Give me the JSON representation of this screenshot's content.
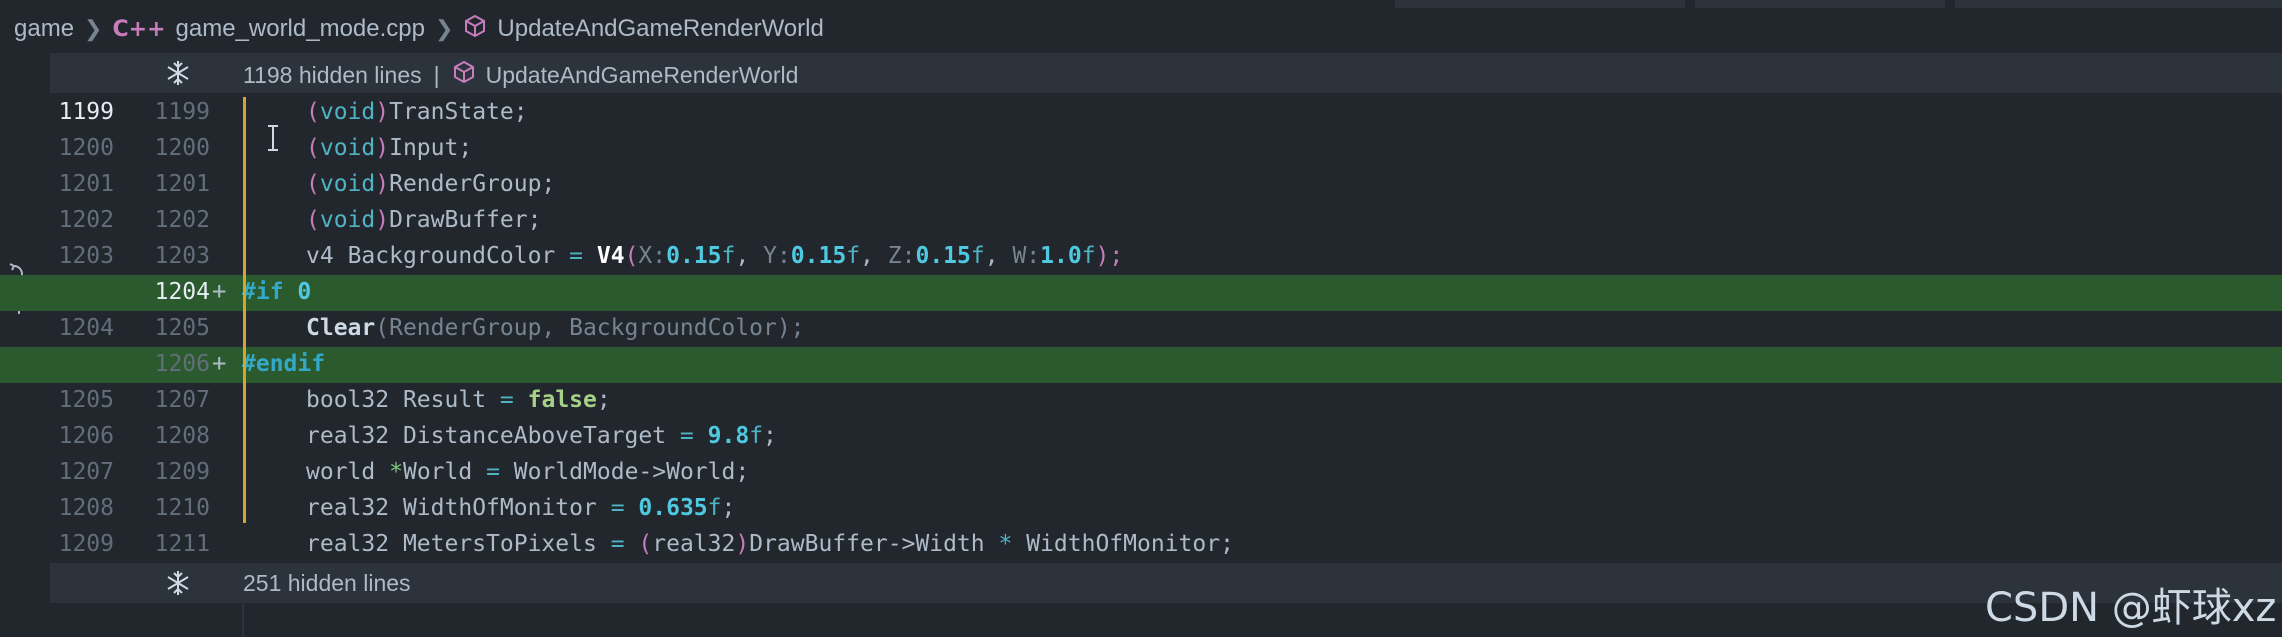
{
  "breadcrumb": {
    "folder": "game",
    "lang_badge": "C++",
    "file": "game_world_mode.cpp",
    "symbol": "UpdateAndGameRenderWorld"
  },
  "hidden_top": {
    "text": "1198 hidden lines",
    "separator": "|",
    "symbol": "UpdateAndGameRenderWorld"
  },
  "hidden_bottom": {
    "text": "251 hidden lines"
  },
  "watermark": "CSDN @虾球xz",
  "lines": [
    {
      "old": "1199",
      "new": "1199"
    },
    {
      "old": "1200",
      "new": "1200"
    },
    {
      "old": "1201",
      "new": "1201"
    },
    {
      "old": "1202",
      "new": "1202"
    },
    {
      "old": "1203",
      "new": "1203"
    },
    {
      "old": "",
      "new": "1204",
      "marker": "+"
    },
    {
      "old": "1204",
      "new": "1205"
    },
    {
      "old": "",
      "new": "1206",
      "marker": "+"
    },
    {
      "old": "1205",
      "new": "1207"
    },
    {
      "old": "1206",
      "new": "1208"
    },
    {
      "old": "1207",
      "new": "1209"
    },
    {
      "old": "1208",
      "new": "1210"
    },
    {
      "old": "1209",
      "new": "1211"
    }
  ],
  "code": {
    "l1": {
      "open": "(",
      "kw": "void",
      "close": ")",
      "rest": "TranState;"
    },
    "l2": {
      "open": "(",
      "kw": "void",
      "close": ")",
      "rest": "Input;"
    },
    "l3": {
      "open": "(",
      "kw": "void",
      "close": ")",
      "rest": "RenderGroup;"
    },
    "l4": {
      "open": "(",
      "kw": "void",
      "close": ")",
      "rest": "DrawBuffer;"
    },
    "l5": {
      "type": "v4",
      "name": "BackgroundColor",
      "eq": "=",
      "fn": "V4",
      "open": "(",
      "px": "X:",
      "x": "0.15",
      "xf": "f",
      "c1": ",",
      "py": "Y:",
      "y": "0.15",
      "yf": "f",
      "c2": ",",
      "pz": "Z:",
      "z": "0.15",
      "zf": "f",
      "c3": ",",
      "pw": "W:",
      "w": "1.0",
      "wf": "f",
      "close": ");"
    },
    "l6": {
      "pre": "#if",
      "val": "0"
    },
    "l7": {
      "fn": "Clear",
      "args": "(RenderGroup, BackgroundColor);"
    },
    "l8": {
      "pre": "#endif"
    },
    "l9": {
      "type": "bool32",
      "name": "Result",
      "eq": "=",
      "val": "false",
      "end": ";"
    },
    "l10": {
      "type": "real32",
      "name": "DistanceAboveTarget",
      "eq": "=",
      "val": "9.8",
      "suffix": "f",
      "end": ";"
    },
    "l11": {
      "type": "world",
      "star": "*",
      "name": "World",
      "eq": "=",
      "rest": "WorldMode->World;"
    },
    "l12": {
      "type": "real32",
      "name": "WidthOfMonitor",
      "eq": "=",
      "val": "0.635",
      "suffix": "f",
      "end": ";"
    },
    "l13": {
      "type": "real32",
      "name": "MetersToPixels",
      "eq": "=",
      "open": "(",
      "cast": "real32",
      "close": ")",
      "mid": "DrawBuffer->Width",
      "op": "*",
      "rest": "WidthOfMonitor;"
    }
  }
}
